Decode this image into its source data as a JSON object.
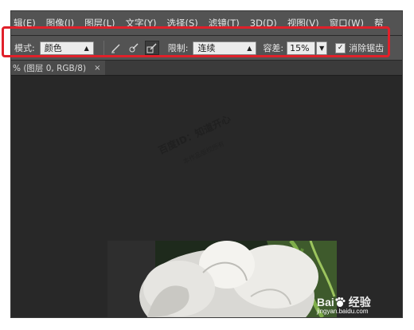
{
  "menubar": {
    "items": [
      "辑(E)",
      "图像(I)",
      "图层(L)",
      "文字(Y)",
      "选择(S)",
      "滤镜(T)",
      "3D(D)",
      "视图(V)",
      "窗口(W)",
      "帮"
    ]
  },
  "options": {
    "mode_label": "模式:",
    "mode_value": "颜色",
    "limit_label": "限制:",
    "limit_value": "连续",
    "tolerance_label": "容差:",
    "tolerance_value": "15%",
    "antialias_label": "消除锯齿",
    "antialias_checked": true
  },
  "document": {
    "tab_title": "% (图层 0, RGB/8)",
    "close_glyph": "×"
  },
  "watermark": {
    "line1": "百度ID：知道开心",
    "line2": "本作品版权所有"
  },
  "branding": {
    "logo_text": "Bai",
    "logo_suffix": "经验",
    "url": "jingyan.baidu.com"
  },
  "colors": {
    "highlight_box": "#e0202a",
    "toolbar_bg": "#535353",
    "canvas_bg": "#282828"
  },
  "icons": [
    "brush-mode-icon",
    "sampling-continuous-icon",
    "sampling-once-icon",
    "sampling-swatch-icon",
    "dropdown-arrow-icon",
    "checkbox-check-icon",
    "baidu-paw-icon"
  ]
}
